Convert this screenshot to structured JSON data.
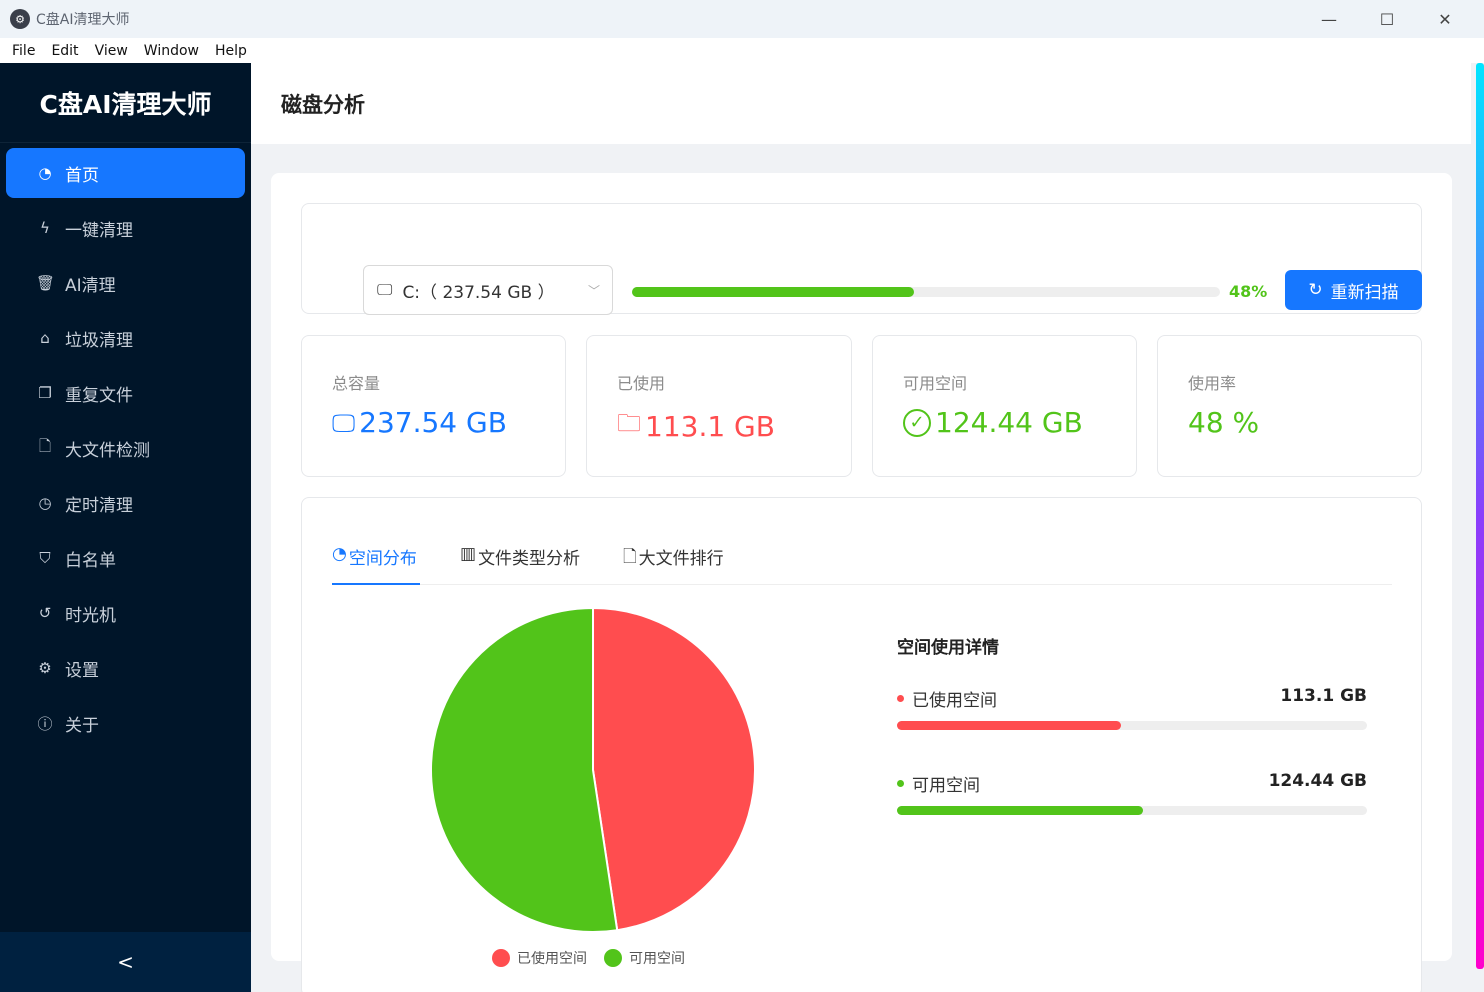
{
  "window": {
    "title": "C盘AI清理大师",
    "minimize": "—",
    "maximize": "☐",
    "close": "✕"
  },
  "menu": [
    "File",
    "Edit",
    "View",
    "Window",
    "Help"
  ],
  "sidebar": {
    "brand": "C盘AI清理大师",
    "items": [
      {
        "label": "首页",
        "icon": "dashboard-icon",
        "glyph": "◔",
        "active": true
      },
      {
        "label": "一键清理",
        "icon": "thunderbolt-icon",
        "glyph": "ϟ"
      },
      {
        "label": "AI清理",
        "icon": "trash-icon",
        "glyph": "🗑"
      },
      {
        "label": "垃圾清理",
        "icon": "bank-icon",
        "glyph": "⌂"
      },
      {
        "label": "重复文件",
        "icon": "file-search-icon",
        "glyph": "❐"
      },
      {
        "label": "大文件检测",
        "icon": "file-icon",
        "glyph": "🗋"
      },
      {
        "label": "定时清理",
        "icon": "clock-icon",
        "glyph": "◷"
      },
      {
        "label": "白名单",
        "icon": "safety-icon",
        "glyph": "⛉"
      },
      {
        "label": "时光机",
        "icon": "history-icon",
        "glyph": "↺"
      },
      {
        "label": "设置",
        "icon": "setting-icon",
        "glyph": "⚙"
      },
      {
        "label": "关于",
        "icon": "info-icon",
        "glyph": "ⓘ"
      }
    ],
    "collapse": "<"
  },
  "header": {
    "title": "磁盘分析"
  },
  "disk": {
    "selected": "C:（ 237.54 GB ）",
    "usage_percent": 48,
    "usage_label": "48%",
    "rescan_label": "重新扫描"
  },
  "stats": [
    {
      "label": "总容量",
      "value": "237.54 GB",
      "icon": "desktop-icon",
      "glyph": "🖵",
      "color": "#1677ff"
    },
    {
      "label": "已使用",
      "value": "113.1 GB",
      "icon": "folder-icon",
      "glyph": "🗀",
      "color": "#ff4d4f"
    },
    {
      "label": "可用空间",
      "value": "124.44 GB",
      "icon": "check-circle-icon",
      "glyph": "✓",
      "color": "#52c41a"
    },
    {
      "label": "使用率",
      "value": "48 %",
      "color": "#52c41a"
    }
  ],
  "tabs": [
    {
      "label": "空间分布",
      "glyph": "◔",
      "active": true
    },
    {
      "label": "文件类型分析",
      "glyph": "▥"
    },
    {
      "label": "大文件排行",
      "glyph": "🗋"
    }
  ],
  "chart_data": {
    "type": "pie",
    "labels": [
      "已使用空间",
      "可用空间"
    ],
    "values": [
      113.1,
      124.44
    ],
    "colors": [
      "#ff4d4f",
      "#52c41a"
    ],
    "legend_position": "bottom"
  },
  "details": {
    "title": "空间使用详情",
    "rows": [
      {
        "label": "已使用空间",
        "value": "113.1 GB",
        "fraction": 0.476,
        "color": "#ff4d4f"
      },
      {
        "label": "可用空间",
        "value": "124.44 GB",
        "fraction": 0.524,
        "color": "#52c41a"
      }
    ]
  }
}
